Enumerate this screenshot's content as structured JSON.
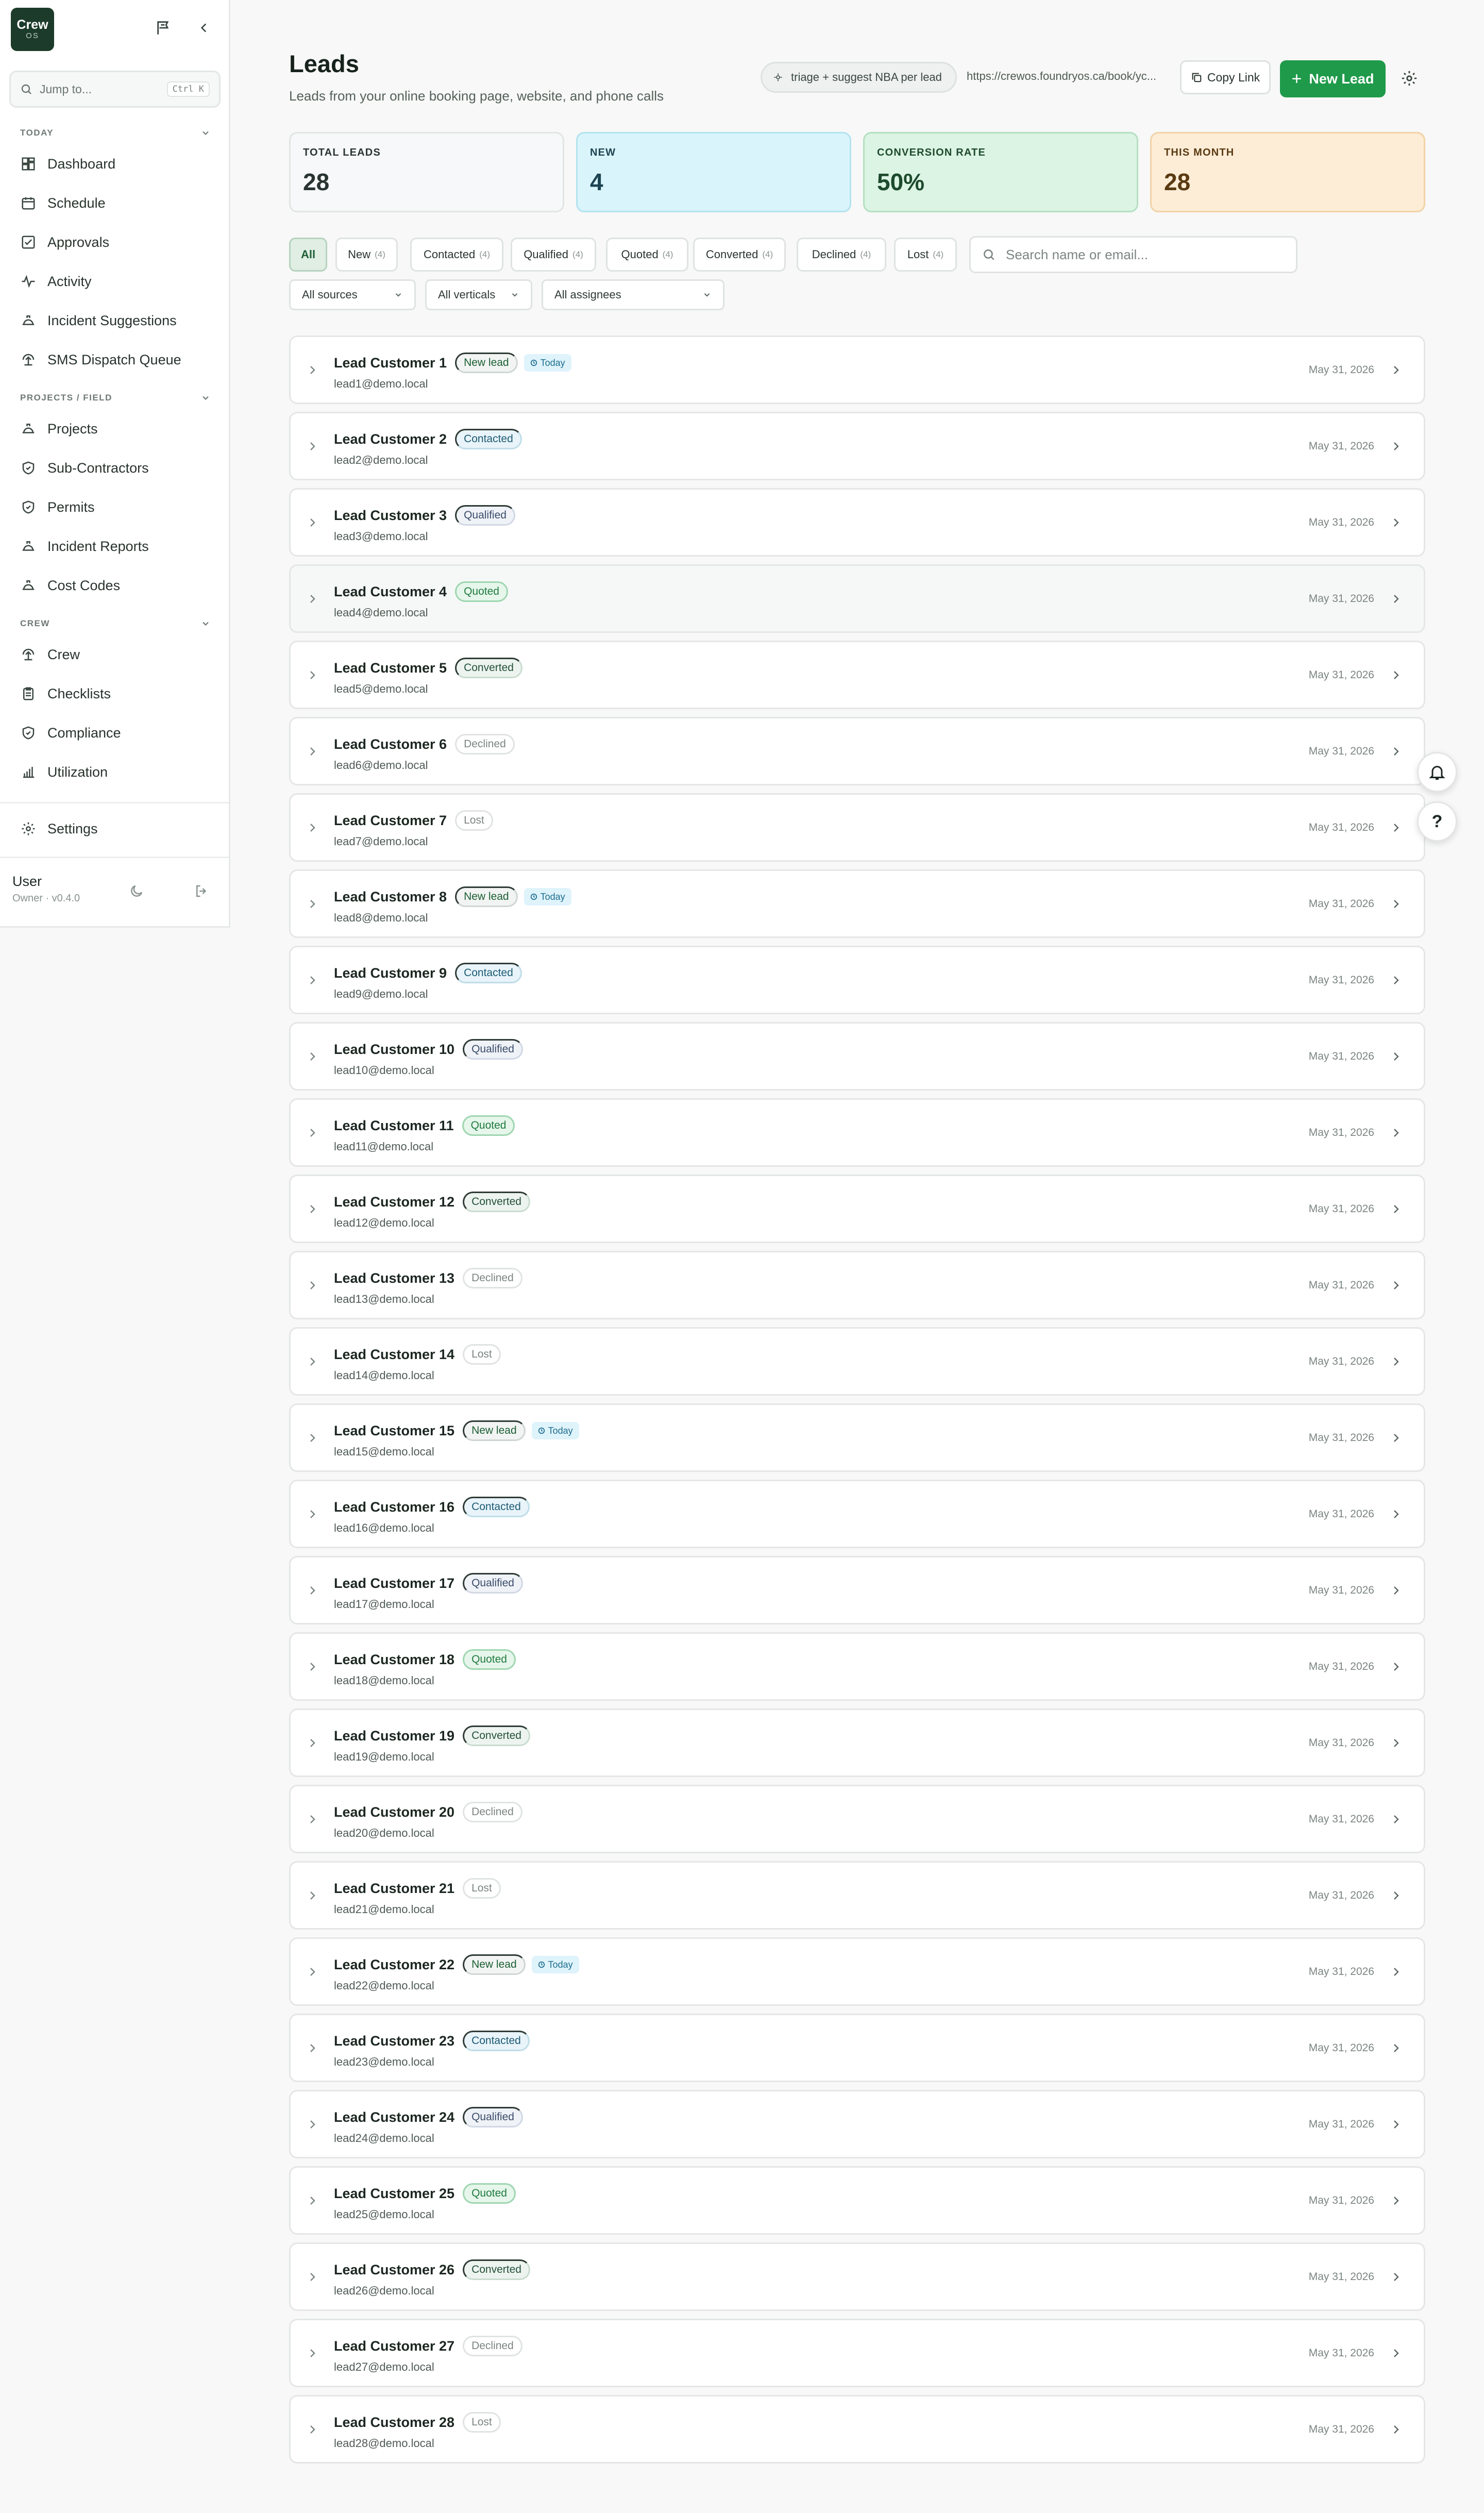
{
  "app": {
    "logo_line1": "Crew",
    "logo_line2": "OS"
  },
  "sidebar": {
    "jump_placeholder": "Jump to...",
    "jump_shortcut": "Ctrl K",
    "sections": [
      {
        "title": "TODAY",
        "items": [
          {
            "label": "Dashboard",
            "icon": "dashboard-icon"
          },
          {
            "label": "Schedule",
            "icon": "calendar-icon"
          },
          {
            "label": "Approvals",
            "icon": "check-square-icon"
          },
          {
            "label": "Activity",
            "icon": "activity-icon"
          },
          {
            "label": "Incident Suggestions",
            "icon": "hard-hat-icon"
          },
          {
            "label": "SMS Dispatch Queue",
            "icon": "crew-icon"
          }
        ]
      },
      {
        "title": "PROJECTS / FIELD",
        "items": [
          {
            "label": "Projects",
            "icon": "hard-hat-icon"
          },
          {
            "label": "Sub-Contractors",
            "icon": "shield-icon"
          },
          {
            "label": "Permits",
            "icon": "shield-icon"
          },
          {
            "label": "Incident Reports",
            "icon": "hard-hat-icon"
          },
          {
            "label": "Cost Codes",
            "icon": "hard-hat-icon"
          }
        ]
      },
      {
        "title": "CREW",
        "items": [
          {
            "label": "Crew",
            "icon": "crew-icon"
          },
          {
            "label": "Checklists",
            "icon": "clipboard-icon"
          },
          {
            "label": "Compliance",
            "icon": "shield-icon"
          },
          {
            "label": "Utilization",
            "icon": "bar-chart-icon"
          }
        ]
      }
    ],
    "settings_label": "Settings",
    "user_name": "User",
    "user_role": "Owner · v0.4.0"
  },
  "header": {
    "title": "Leads",
    "subtitle": "Leads from your online booking page, website, and phone calls",
    "ai_chip": "triage + suggest NBA per lead",
    "booking_url": "https://crewos.foundryos.ca/book/yc...",
    "copy_label": "Copy Link",
    "new_lead_label": "New Lead"
  },
  "stats": [
    {
      "label": "TOTAL LEADS",
      "value": "28",
      "bg": "#f6f8f9",
      "border": "#e1e5e3",
      "color": "#2a3430"
    },
    {
      "label": "NEW",
      "value": "4",
      "bg": "#d9f4fb",
      "border": "#b3e3ef",
      "color": "#1d4452"
    },
    {
      "label": "CONVERSION RATE",
      "value": "50%",
      "bg": "#dcf4e4",
      "border": "#b4e0c2",
      "color": "#1d4a2d"
    },
    {
      "label": "THIS MONTH",
      "value": "28",
      "bg": "#fdedd7",
      "border": "#f3d2a6",
      "color": "#5a3a12"
    }
  ],
  "filters": {
    "tabs": [
      {
        "label": "All",
        "count": ""
      },
      {
        "label": "New",
        "count": "(4)"
      },
      {
        "label": "Contacted",
        "count": "(4)"
      },
      {
        "label": "Qualified",
        "count": "(4)"
      },
      {
        "label": "Quoted",
        "count": "(4)"
      },
      {
        "label": "Converted",
        "count": "(4)"
      },
      {
        "label": "Declined",
        "count": "(4)"
      },
      {
        "label": "Lost",
        "count": "(4)"
      }
    ],
    "search_placeholder": "Search name or email...",
    "sources": "All sources",
    "verticals": "All verticals",
    "assignees": "All assignees"
  },
  "today_label": "Today",
  "leads": [
    {
      "name": "Lead Customer 1",
      "email": "lead1@demo.local",
      "status": "New lead",
      "kind": "new",
      "today": true,
      "date": "May 31, 2026"
    },
    {
      "name": "Lead Customer 2",
      "email": "lead2@demo.local",
      "status": "Contacted",
      "kind": "contacted",
      "today": false,
      "date": "May 31, 2026"
    },
    {
      "name": "Lead Customer 3",
      "email": "lead3@demo.local",
      "status": "Qualified",
      "kind": "qualified",
      "today": false,
      "date": "May 31, 2026"
    },
    {
      "name": "Lead Customer 4",
      "email": "lead4@demo.local",
      "status": "Quoted",
      "kind": "quoted",
      "today": false,
      "date": "May 31, 2026"
    },
    {
      "name": "Lead Customer 5",
      "email": "lead5@demo.local",
      "status": "Converted",
      "kind": "converted",
      "today": false,
      "date": "May 31, 2026"
    },
    {
      "name": "Lead Customer 6",
      "email": "lead6@demo.local",
      "status": "Declined",
      "kind": "declined",
      "today": false,
      "date": "May 31, 2026"
    },
    {
      "name": "Lead Customer 7",
      "email": "lead7@demo.local",
      "status": "Lost",
      "kind": "lost",
      "today": false,
      "date": "May 31, 2026"
    },
    {
      "name": "Lead Customer 8",
      "email": "lead8@demo.local",
      "status": "New lead",
      "kind": "new",
      "today": true,
      "date": "May 31, 2026"
    },
    {
      "name": "Lead Customer 9",
      "email": "lead9@demo.local",
      "status": "Contacted",
      "kind": "contacted",
      "today": false,
      "date": "May 31, 2026"
    },
    {
      "name": "Lead Customer 10",
      "email": "lead10@demo.local",
      "status": "Qualified",
      "kind": "qualified",
      "today": false,
      "date": "May 31, 2026"
    },
    {
      "name": "Lead Customer 11",
      "email": "lead11@demo.local",
      "status": "Quoted",
      "kind": "quoted",
      "today": false,
      "date": "May 31, 2026"
    },
    {
      "name": "Lead Customer 12",
      "email": "lead12@demo.local",
      "status": "Converted",
      "kind": "converted",
      "today": false,
      "date": "May 31, 2026"
    },
    {
      "name": "Lead Customer 13",
      "email": "lead13@demo.local",
      "status": "Declined",
      "kind": "declined",
      "today": false,
      "date": "May 31, 2026"
    },
    {
      "name": "Lead Customer 14",
      "email": "lead14@demo.local",
      "status": "Lost",
      "kind": "lost",
      "today": false,
      "date": "May 31, 2026"
    },
    {
      "name": "Lead Customer 15",
      "email": "lead15@demo.local",
      "status": "New lead",
      "kind": "new",
      "today": true,
      "date": "May 31, 2026"
    },
    {
      "name": "Lead Customer 16",
      "email": "lead16@demo.local",
      "status": "Contacted",
      "kind": "contacted",
      "today": false,
      "date": "May 31, 2026"
    },
    {
      "name": "Lead Customer 17",
      "email": "lead17@demo.local",
      "status": "Qualified",
      "kind": "qualified",
      "today": false,
      "date": "May 31, 2026"
    },
    {
      "name": "Lead Customer 18",
      "email": "lead18@demo.local",
      "status": "Quoted",
      "kind": "quoted",
      "today": false,
      "date": "May 31, 2026"
    },
    {
      "name": "Lead Customer 19",
      "email": "lead19@demo.local",
      "status": "Converted",
      "kind": "converted",
      "today": false,
      "date": "May 31, 2026"
    },
    {
      "name": "Lead Customer 20",
      "email": "lead20@demo.local",
      "status": "Declined",
      "kind": "declined",
      "today": false,
      "date": "May 31, 2026"
    },
    {
      "name": "Lead Customer 21",
      "email": "lead21@demo.local",
      "status": "Lost",
      "kind": "lost",
      "today": false,
      "date": "May 31, 2026"
    },
    {
      "name": "Lead Customer 22",
      "email": "lead22@demo.local",
      "status": "New lead",
      "kind": "new",
      "today": true,
      "date": "May 31, 2026"
    },
    {
      "name": "Lead Customer 23",
      "email": "lead23@demo.local",
      "status": "Contacted",
      "kind": "contacted",
      "today": false,
      "date": "May 31, 2026"
    },
    {
      "name": "Lead Customer 24",
      "email": "lead24@demo.local",
      "status": "Qualified",
      "kind": "qualified",
      "today": false,
      "date": "May 31, 2026"
    },
    {
      "name": "Lead Customer 25",
      "email": "lead25@demo.local",
      "status": "Quoted",
      "kind": "quoted",
      "today": false,
      "date": "May 31, 2026"
    },
    {
      "name": "Lead Customer 26",
      "email": "lead26@demo.local",
      "status": "Converted",
      "kind": "converted",
      "today": false,
      "date": "May 31, 2026"
    },
    {
      "name": "Lead Customer 27",
      "email": "lead27@demo.local",
      "status": "Declined",
      "kind": "declined",
      "today": false,
      "date": "May 31, 2026"
    },
    {
      "name": "Lead Customer 28",
      "email": "lead28@demo.local",
      "status": "Lost",
      "kind": "lost",
      "today": false,
      "date": "May 31, 2026"
    }
  ],
  "floating": {
    "help_label": "?"
  }
}
